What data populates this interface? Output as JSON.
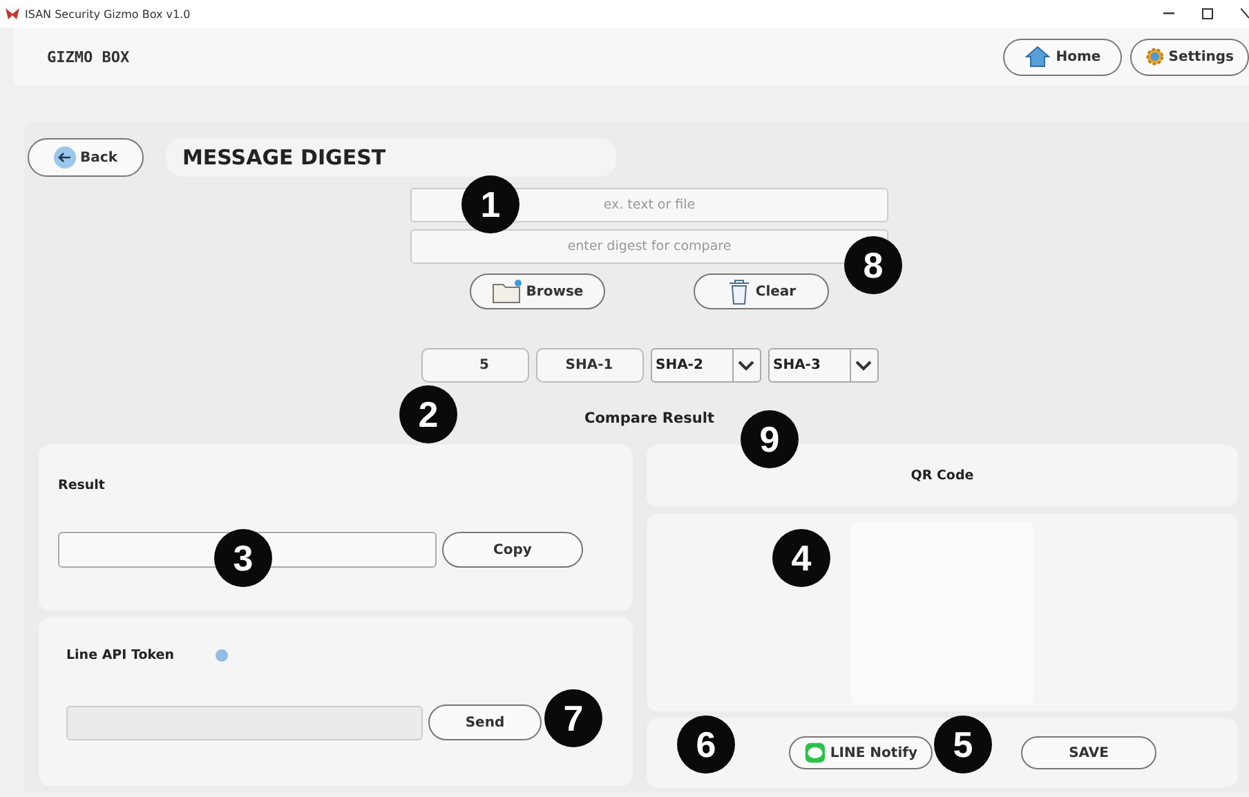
{
  "window": {
    "title": "ISAN Security Gizmo Box v1.0"
  },
  "header": {
    "logo": "GIZMO BOX",
    "nav": [
      {
        "label": "Home",
        "kind": "home"
      },
      {
        "label": "Settings",
        "kind": "settings"
      }
    ]
  },
  "page": {
    "back": "Back",
    "title": "MESSAGE DIGEST"
  },
  "inputs": [
    {
      "placeholder": "ex. text or file"
    },
    {
      "placeholder": "enter digest for compare"
    }
  ],
  "file_buttons": [
    {
      "label": "Browse",
      "kind": "browse"
    },
    {
      "label": "Clear",
      "kind": "clear"
    }
  ],
  "algorithms": [
    {
      "label": "5",
      "kind": "button"
    },
    {
      "label": "SHA-1",
      "kind": "button"
    },
    {
      "label": "SHA-2",
      "kind": "dropdown"
    },
    {
      "label": "SHA-3",
      "kind": "dropdown"
    }
  ],
  "compare_result": "Compare Result",
  "result_panel": {
    "label": "Result",
    "button": "Copy"
  },
  "line_panel": {
    "label": "Line API Token",
    "button": "Send"
  },
  "qr_panel": {
    "label": "QR Code"
  },
  "actions": [
    {
      "label": "LINE Notify",
      "kind": "line"
    },
    {
      "label": "SAVE",
      "kind": "plain"
    }
  ],
  "callouts": [
    {
      "number": "1"
    },
    {
      "number": "8"
    },
    {
      "number": "2"
    },
    {
      "number": "9"
    },
    {
      "number": "3"
    },
    {
      "number": "4"
    },
    {
      "number": "7"
    },
    {
      "number": "6"
    },
    {
      "number": "5"
    }
  ]
}
